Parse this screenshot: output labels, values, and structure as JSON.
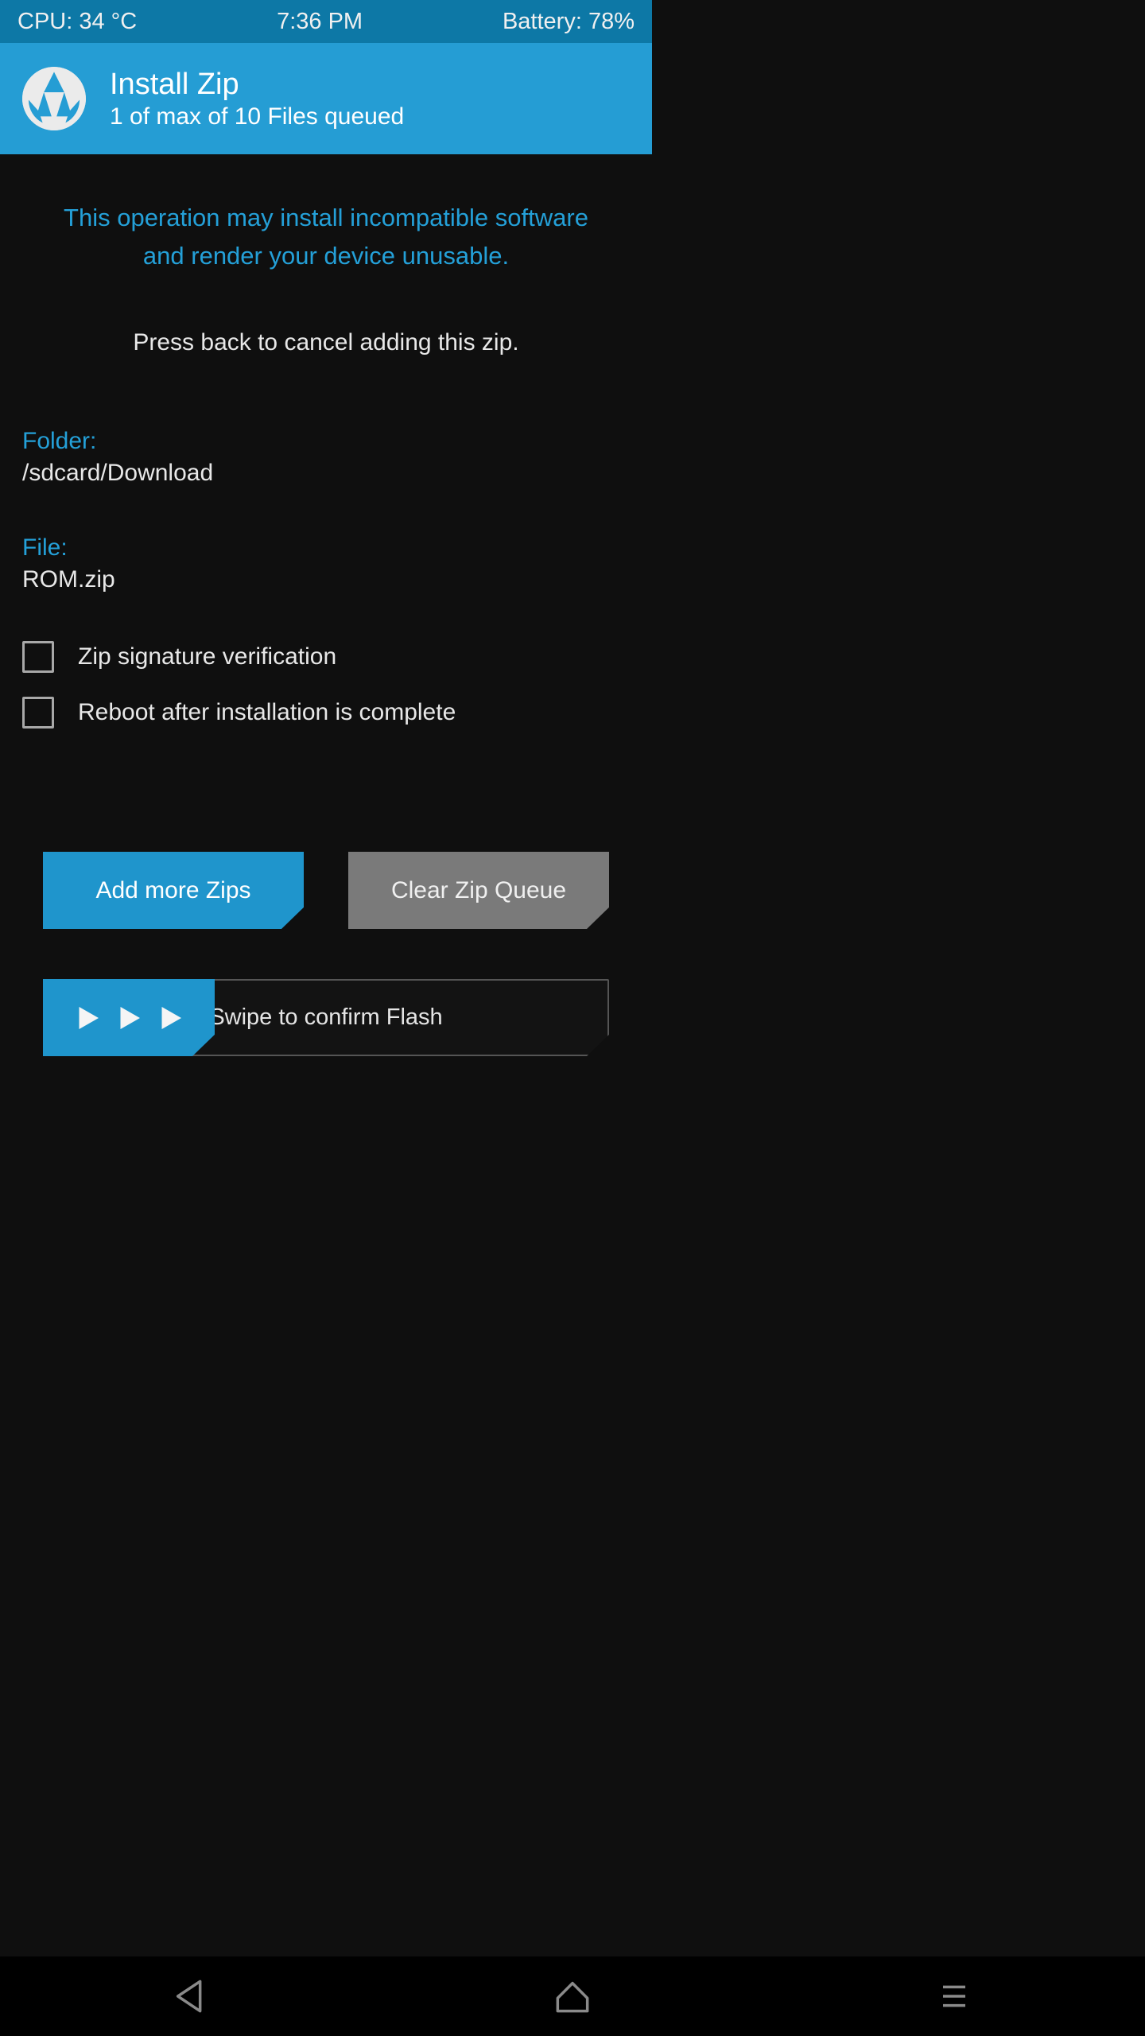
{
  "statusbar": {
    "cpu": "CPU: 34 °C",
    "time": "7:36 PM",
    "battery": "Battery: 78%"
  },
  "header": {
    "title": "Install Zip",
    "subtitle": "1 of max of 10 Files queued"
  },
  "content": {
    "warning": "This operation may install incompatible software and render your device unusable.",
    "hint": "Press back to cancel adding this zip.",
    "folder_label": "Folder:",
    "folder_value": "/sdcard/Download",
    "file_label": "File:",
    "file_value": "ROM.zip",
    "checkbox_sig": "Zip signature verification",
    "checkbox_reboot": "Reboot after installation is complete"
  },
  "buttons": {
    "add_more": "Add more Zips",
    "clear_queue": "Clear Zip Queue",
    "swipe": "Swipe to confirm Flash"
  }
}
